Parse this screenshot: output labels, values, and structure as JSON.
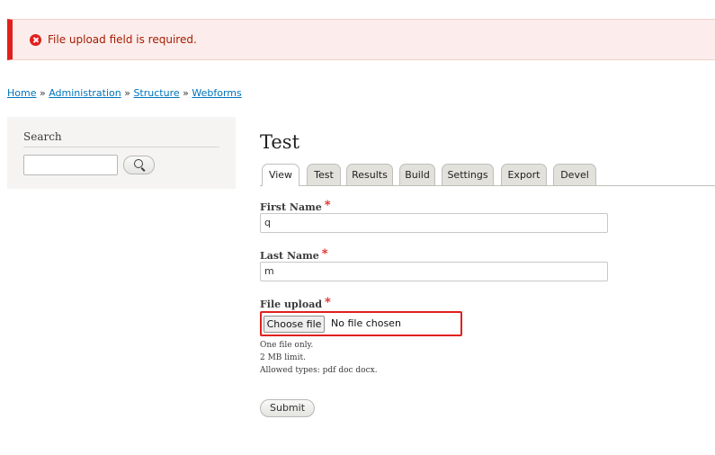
{
  "message": {
    "icon": "error-icon",
    "text": "File upload field is required.",
    "color": "#e0201d"
  },
  "breadcrumb": {
    "items": [
      "Home",
      "Administration",
      "Structure",
      "Webforms"
    ],
    "separator": "»"
  },
  "sidebar": {
    "search_title": "Search",
    "search_value": "",
    "search_button_icon": "search-icon"
  },
  "page": {
    "title": "Test",
    "tabs": [
      "View",
      "Test",
      "Results",
      "Build",
      "Settings",
      "Export",
      "Devel"
    ],
    "active_tab": "View"
  },
  "form": {
    "first_name": {
      "label": "First Name",
      "required_mark": "*",
      "value": "q"
    },
    "last_name": {
      "label": "Last Name",
      "required_mark": "*",
      "value": "m"
    },
    "file_upload": {
      "label": "File upload",
      "required_mark": "*",
      "button_label": "Choose file",
      "status": "No file chosen",
      "descriptions": [
        "One file only.",
        "2 MB limit.",
        "Allowed types: pdf doc docx."
      ]
    },
    "submit_label": "Submit"
  }
}
